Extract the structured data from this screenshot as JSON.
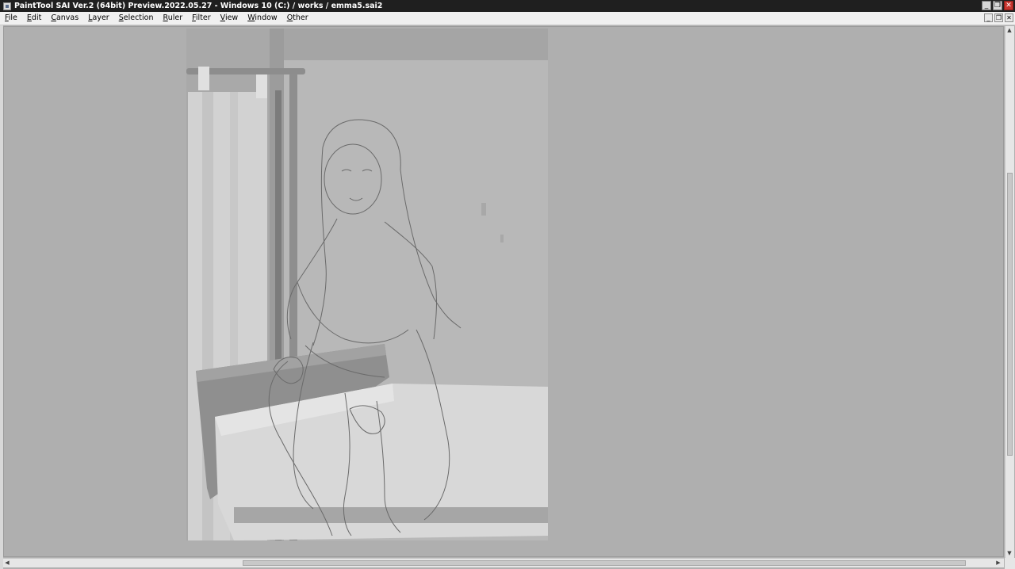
{
  "window": {
    "title": "PaintTool SAI Ver.2 (64bit) Preview.2022.05.27 - Windows 10 (C:) / works / emma5.sai2",
    "minimize_glyph": "_",
    "maximize_glyph": "❐",
    "close_glyph": "✕"
  },
  "menu": {
    "items": [
      "File",
      "Edit",
      "Canvas",
      "Layer",
      "Selection",
      "Ruler",
      "Filter",
      "View",
      "Window",
      "Other"
    ]
  },
  "mdi": {
    "minimize_glyph": "_",
    "restore_glyph": "❐",
    "close_glyph": "✕"
  },
  "scroll": {
    "up": "▲",
    "down": "▼",
    "left": "◀",
    "right": "▶"
  },
  "colors": {
    "titlebar": "#1f1f1f",
    "workspace": "#afafaf",
    "close_button": "#c8352e"
  }
}
